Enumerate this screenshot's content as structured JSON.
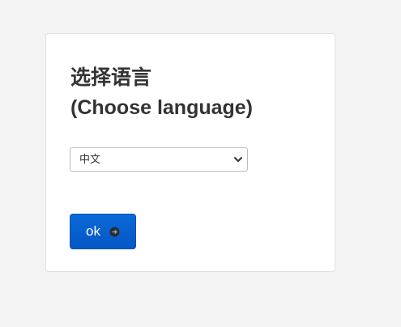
{
  "dialog": {
    "title_line1": "选择语言",
    "title_line2": "(Choose language)",
    "language_select": {
      "selected": "中文"
    },
    "ok_button": {
      "label": "ok",
      "icon": "arrow-circle-icon"
    }
  },
  "colors": {
    "page_bg": "#f4f4f4",
    "card_bg": "#ffffff",
    "button_bg": "#0a64d2",
    "text": "#333333"
  }
}
